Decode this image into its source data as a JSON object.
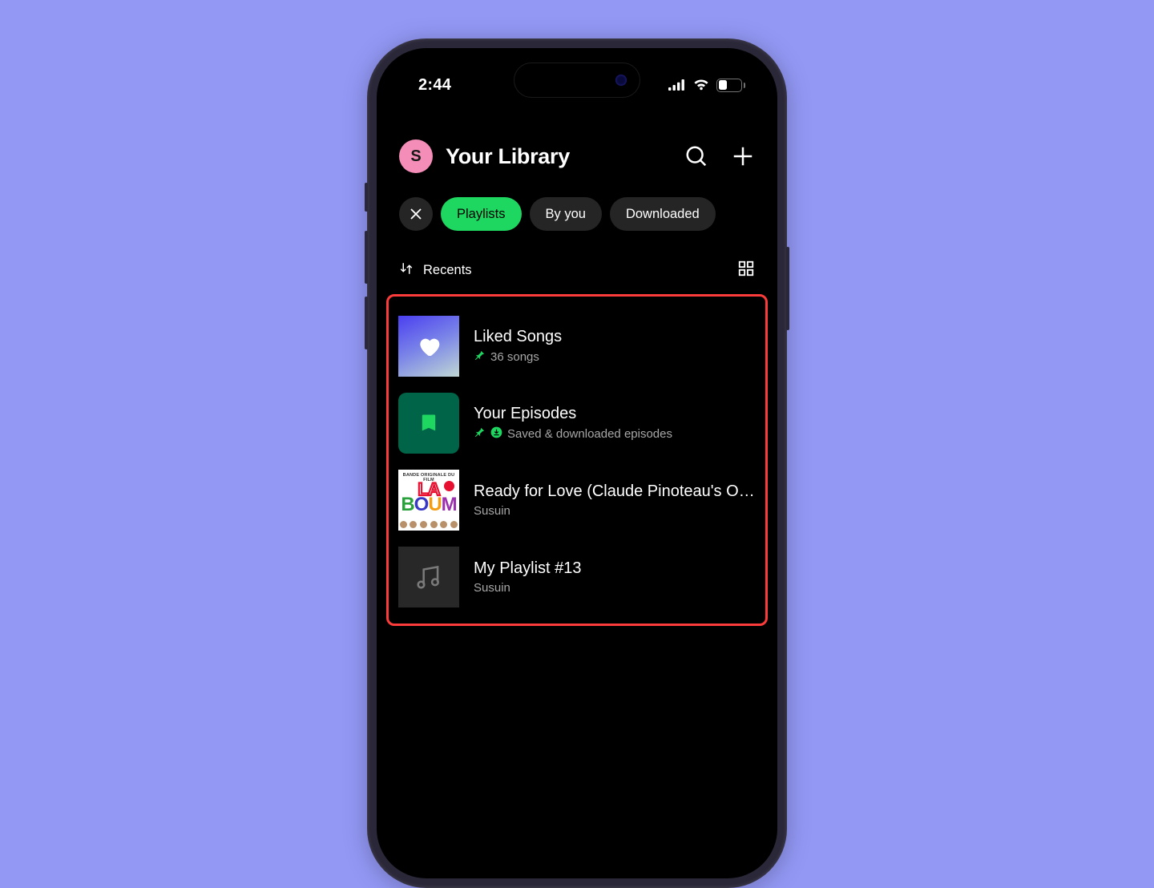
{
  "status": {
    "time": "2:44",
    "battery": "38"
  },
  "header": {
    "avatar_letter": "S",
    "title": "Your Library"
  },
  "filters": {
    "items": [
      {
        "label": "Playlists",
        "active": true
      },
      {
        "label": "By you",
        "active": false
      },
      {
        "label": "Downloaded",
        "active": false
      }
    ]
  },
  "sort": {
    "label": "Recents"
  },
  "list": [
    {
      "title": "Liked Songs",
      "subtitle": "36 songs",
      "pinned": true,
      "downloaded": false,
      "cover": "liked"
    },
    {
      "title": "Your Episodes",
      "subtitle": "Saved & downloaded episodes",
      "pinned": true,
      "downloaded": true,
      "cover": "episodes"
    },
    {
      "title": "Ready for Love (Claude Pinoteau's Or…",
      "subtitle": "Susuin",
      "pinned": false,
      "downloaded": false,
      "cover": "boum"
    },
    {
      "title": "My Playlist #13",
      "subtitle": "Susuin",
      "pinned": false,
      "downloaded": false,
      "cover": "generic"
    }
  ]
}
